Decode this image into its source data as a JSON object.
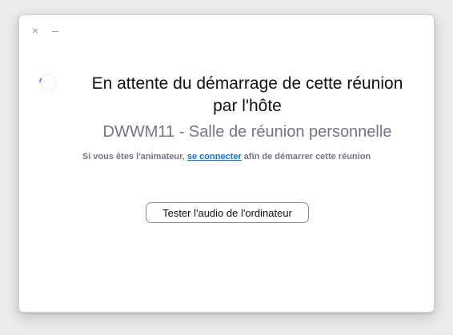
{
  "window": {
    "close_glyph": "×",
    "minimize_glyph": "–"
  },
  "waiting": {
    "title_line1": "En attente du démarrage de cette réunion",
    "title_line2": "par l'hôte",
    "meeting_name": "DWWM11 - Salle de réunion personnelle",
    "note_before": "Si vous êtes l'animateur, ",
    "note_link": "se connecter",
    "note_after": " afin de démarrer cette réunion",
    "audio_button_label": "Tester l'audio de l'ordinateur"
  },
  "icons": {
    "close": "close-icon",
    "minimize": "minimize-icon",
    "spinner": "loading-spinner-icon"
  },
  "colors": {
    "title": "#111111",
    "subtitle": "#747487",
    "link": "#0e71eb",
    "spinner_accent": "#2d8cff"
  }
}
